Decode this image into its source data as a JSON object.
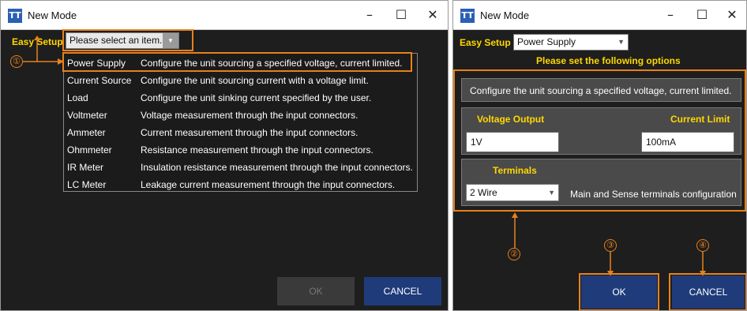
{
  "left_window": {
    "title": "New Mode",
    "icon_text": "TT",
    "easy_setup_label": "Easy Setup",
    "select_placeholder": "Please select an item...",
    "menu_items": [
      {
        "name": "Power Supply",
        "desc": "Configure the unit sourcing a specified voltage, current limited."
      },
      {
        "name": "Current Source",
        "desc": "Configure the unit sourcing current with a voltage limit."
      },
      {
        "name": "Load",
        "desc": "Configure the unit sinking current specified by the user."
      },
      {
        "name": "Voltmeter",
        "desc": "Voltage measurement through the input connectors."
      },
      {
        "name": "Ammeter",
        "desc": "Current measurement through the input connectors."
      },
      {
        "name": "Ohmmeter",
        "desc": "Resistance measurement through the input connectors."
      },
      {
        "name": "IR Meter",
        "desc": "Insulation resistance measurement through the input connectors."
      },
      {
        "name": "LC Meter",
        "desc": "Leakage current measurement through the input connectors."
      }
    ],
    "ok_label": "OK",
    "cancel_label": "CANCEL",
    "callout": "①"
  },
  "right_window": {
    "title": "New Mode",
    "icon_text": "TT",
    "easy_setup_label": "Easy Setup",
    "select_value": "Power Supply",
    "options_heading": "Please set the following options",
    "description": "Configure the unit sourcing a specified voltage, current limited.",
    "voltage_label": "Voltage Output",
    "voltage_value": "1V",
    "current_label": "Current Limit",
    "current_value": "100mA",
    "terminals_label": "Terminals",
    "terminals_value": "2 Wire",
    "terminals_desc": "Main and Sense terminals configuration",
    "ok_label": "OK",
    "cancel_label": "CANCEL",
    "callouts": [
      "②",
      "③",
      "④"
    ]
  },
  "colors": {
    "accent": "#e8811c",
    "label_yellow": "#ffd700",
    "button_blue": "#1f3b7a",
    "window_bg": "#1e1e1e"
  }
}
